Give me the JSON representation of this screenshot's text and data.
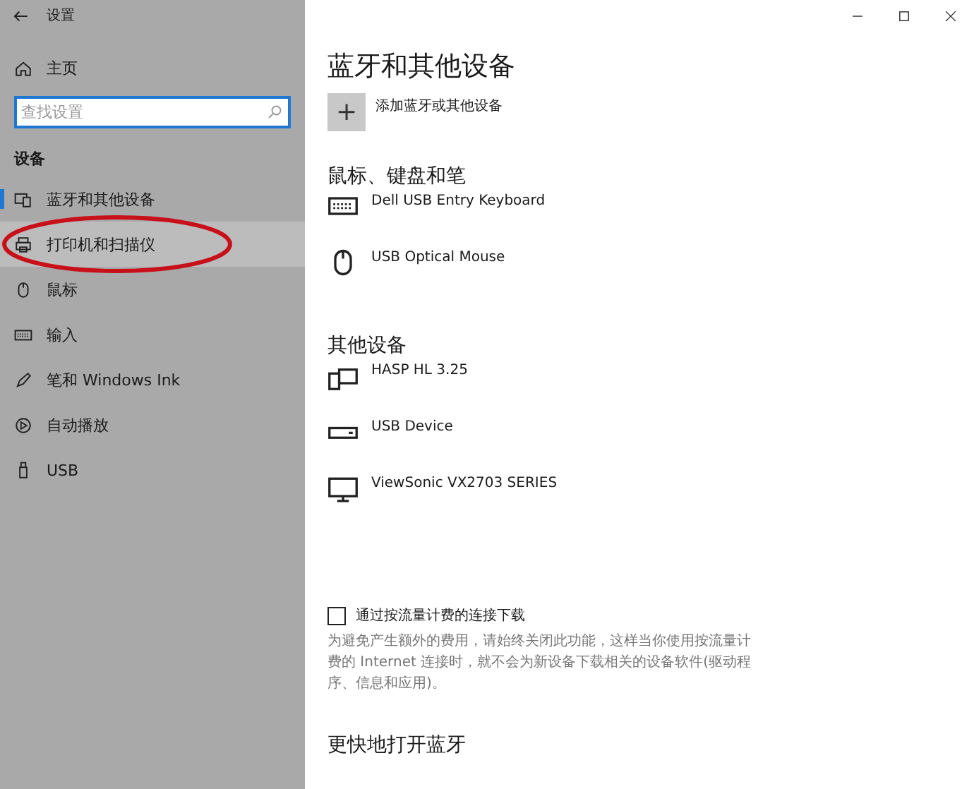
{
  "window": {
    "title": "设置",
    "controls": [
      {
        "kind": "minimize"
      },
      {
        "kind": "maximize"
      },
      {
        "kind": "close"
      }
    ]
  },
  "sidebar": {
    "home": "主页",
    "search": {
      "placeholder": "查找设置"
    },
    "section": "设备",
    "items": [
      {
        "label": "蓝牙和其他设备",
        "kind": "bluetooth",
        "selected": true,
        "hovered": false,
        "circled": false
      },
      {
        "label": "打印机和扫描仪",
        "kind": "printer",
        "selected": false,
        "hovered": true,
        "circled": true
      },
      {
        "label": "鼠标",
        "kind": "mouse",
        "selected": false,
        "hovered": false,
        "circled": false
      },
      {
        "label": "输入",
        "kind": "keyboard",
        "selected": false,
        "hovered": false,
        "circled": false
      },
      {
        "label": "笔和 Windows Ink",
        "kind": "pen",
        "selected": false,
        "hovered": false,
        "circled": false
      },
      {
        "label": "自动播放",
        "kind": "autoplay",
        "selected": false,
        "hovered": false,
        "circled": false
      },
      {
        "label": "USB",
        "kind": "usb",
        "selected": false,
        "hovered": false,
        "circled": false
      }
    ]
  },
  "page": {
    "title": "蓝牙和其他设备",
    "add_button": {
      "label": "添加蓝牙或其他设备",
      "icon": "+"
    },
    "groups": [
      {
        "title": "鼠标、键盘和笔",
        "devices": [
          {
            "name": "Dell USB Entry Keyboard",
            "kind": "keyboard"
          },
          {
            "name": "USB Optical Mouse",
            "kind": "mouse"
          }
        ]
      },
      {
        "title": "其他设备",
        "devices": [
          {
            "name": "HASP HL 3.25",
            "kind": "device"
          },
          {
            "name": "USB Device",
            "kind": "drive"
          },
          {
            "name": "ViewSonic VX2703 SERIES",
            "kind": "monitor"
          }
        ]
      }
    ],
    "metered": {
      "label": "通过按流量计费的连接下载",
      "checked": false,
      "description": "为避免产生额外的费用，请始终关闭此功能，这样当你使用按流量计费的 Internet 连接时，就不会为新设备下载相关的设备软件(驱动程序、信息和应用)。"
    },
    "section2": {
      "title": "更快地打开蓝牙"
    }
  }
}
